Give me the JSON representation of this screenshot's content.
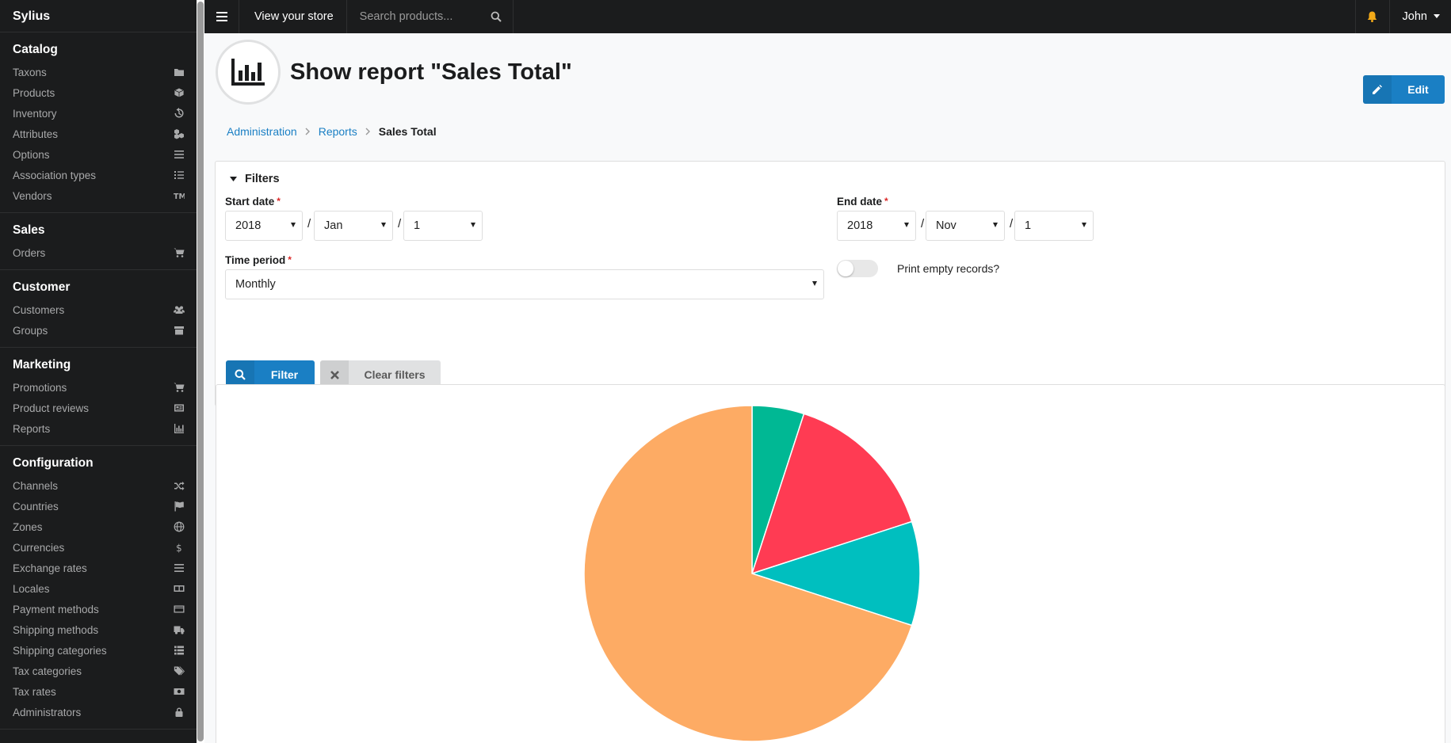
{
  "app": {
    "brand": "Sylius"
  },
  "topbar": {
    "view_store": "View your store",
    "search_placeholder": "Search products...",
    "user": "John"
  },
  "sidebar": {
    "sections": [
      {
        "header": "Catalog",
        "items": [
          {
            "label": "Taxons",
            "icon": "folder-icon"
          },
          {
            "label": "Products",
            "icon": "cube-icon"
          },
          {
            "label": "Inventory",
            "icon": "history-icon"
          },
          {
            "label": "Attributes",
            "icon": "cubes-icon"
          },
          {
            "label": "Options",
            "icon": "options-icon"
          },
          {
            "label": "Association types",
            "icon": "tasks-icon"
          },
          {
            "label": "Vendors",
            "icon": "trademark-icon"
          }
        ]
      },
      {
        "header": "Sales",
        "items": [
          {
            "label": "Orders",
            "icon": "cart-icon"
          }
        ]
      },
      {
        "header": "Customer",
        "items": [
          {
            "label": "Customers",
            "icon": "users-icon"
          },
          {
            "label": "Groups",
            "icon": "archive-icon"
          }
        ]
      },
      {
        "header": "Marketing",
        "items": [
          {
            "label": "Promotions",
            "icon": "cart-plus-icon"
          },
          {
            "label": "Product reviews",
            "icon": "newspaper-icon"
          },
          {
            "label": "Reports",
            "icon": "bar-chart-icon"
          }
        ]
      },
      {
        "header": "Configuration",
        "items": [
          {
            "label": "Channels",
            "icon": "shuffle-icon"
          },
          {
            "label": "Countries",
            "icon": "flag-icon"
          },
          {
            "label": "Zones",
            "icon": "globe-icon"
          },
          {
            "label": "Currencies",
            "icon": "dollar-icon"
          },
          {
            "label": "Exchange rates",
            "icon": "sliders-icon"
          },
          {
            "label": "Locales",
            "icon": "translate-icon"
          },
          {
            "label": "Payment methods",
            "icon": "credit-card-icon"
          },
          {
            "label": "Shipping methods",
            "icon": "truck-icon"
          },
          {
            "label": "Shipping categories",
            "icon": "list-icon"
          },
          {
            "label": "Tax categories",
            "icon": "tags-icon"
          },
          {
            "label": "Tax rates",
            "icon": "money-icon"
          },
          {
            "label": "Administrators",
            "icon": "lock-icon"
          }
        ]
      }
    ]
  },
  "page": {
    "title": "Show report \"Sales Total\"",
    "edit_label": "Edit",
    "breadcrumb": [
      "Administration",
      "Reports",
      "Sales Total"
    ]
  },
  "filters": {
    "title": "Filters",
    "start_date_label": "Start date",
    "start_year": "2018",
    "start_month": "Jan",
    "start_day": "1",
    "end_date_label": "End date",
    "end_year": "2018",
    "end_month": "Nov",
    "end_day": "1",
    "time_period_label": "Time period",
    "time_period_value": "Monthly",
    "print_empty_label": "Print empty records?",
    "filter_button": "Filter",
    "clear_button": "Clear filters",
    "required_mark": "*",
    "date_separator": "/"
  },
  "chart_data": {
    "type": "pie",
    "values": [
      5,
      15,
      10,
      70
    ],
    "colors": [
      "#00b894",
      "#ff3b53",
      "#00bfbf",
      "#fdab64"
    ]
  }
}
